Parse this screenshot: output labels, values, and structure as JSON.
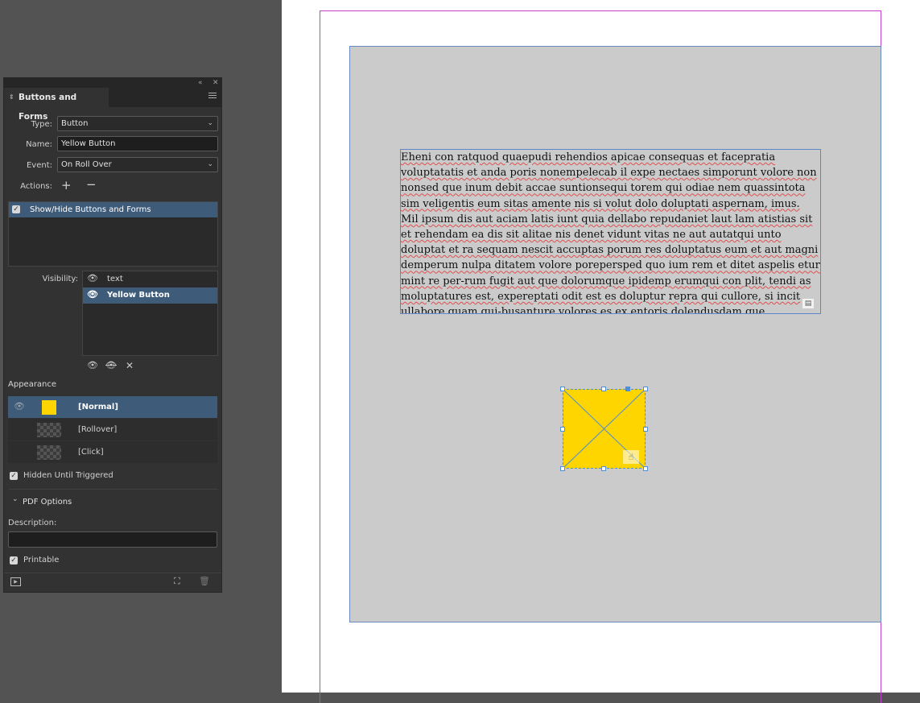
{
  "panel": {
    "title": "Buttons and Forms",
    "collapse_icon": "double-chevron-left-icon",
    "close_icon": "close-icon",
    "menu_icon": "hamburger-menu-icon",
    "type_label": "Type:",
    "type_value": "Button",
    "name_label": "Name:",
    "name_value": "Yellow Button",
    "event_label": "Event:",
    "event_value": "On Roll Over",
    "actions_label": "Actions:",
    "actions": [
      {
        "label": "Show/Hide Buttons and Forms",
        "checked": true
      }
    ],
    "visibility_label": "Visibility:",
    "visibility_items": [
      {
        "label": "text"
      },
      {
        "label": "Yellow Button",
        "selected": true
      }
    ],
    "appearance_label": "Appearance",
    "appearance_states": [
      {
        "label": "[Normal]",
        "color": "#ffd500",
        "selected": true
      },
      {
        "label": "[Rollover]"
      },
      {
        "label": "[Click]"
      }
    ],
    "hidden_until_triggered": {
      "label": "Hidden Until Triggered",
      "checked": true
    },
    "pdf_options_label": "PDF Options",
    "description_label": "Description:",
    "description_value": "",
    "printable": {
      "label": "Printable",
      "checked": true
    }
  },
  "document": {
    "paragraph1": "Eheni con ratquod quaepudi rehendios apicae consequas et facepratia voluptatatis et anda poris nonempelecab il expe nectaes simporunt volore non nonsed que inum debit accae suntionsequi torem qui odiae nem quassintota sim veligentis eum sitas amente nis si volut dolo doluptati aspernam, imus.",
    "paragraph2": "Mil ipsum dis aut aciam latis iunt quia dellabo repudaniet laut lam atistias sit et rehendam ea dis sit alitae nis denet vidunt vitas ne aut autatqui unto doluptat et ra sequam nescit accuptas porum res doluptatus eum et aut magni demperum nulpa ditatem volore porepersped quo ium rem et ditet aspelis etur mint re per-rum fugit aut que dolorumque ipidemp erumqui con plit, tendi as moluptatures est, expereptati odit est es doluptur repra qui cullore, si incit ullabore quam qui-busanture volores es ex entoris dolendusdam que volorrovit, sam iunt atur ma nim",
    "button_color": "#ffd500"
  }
}
